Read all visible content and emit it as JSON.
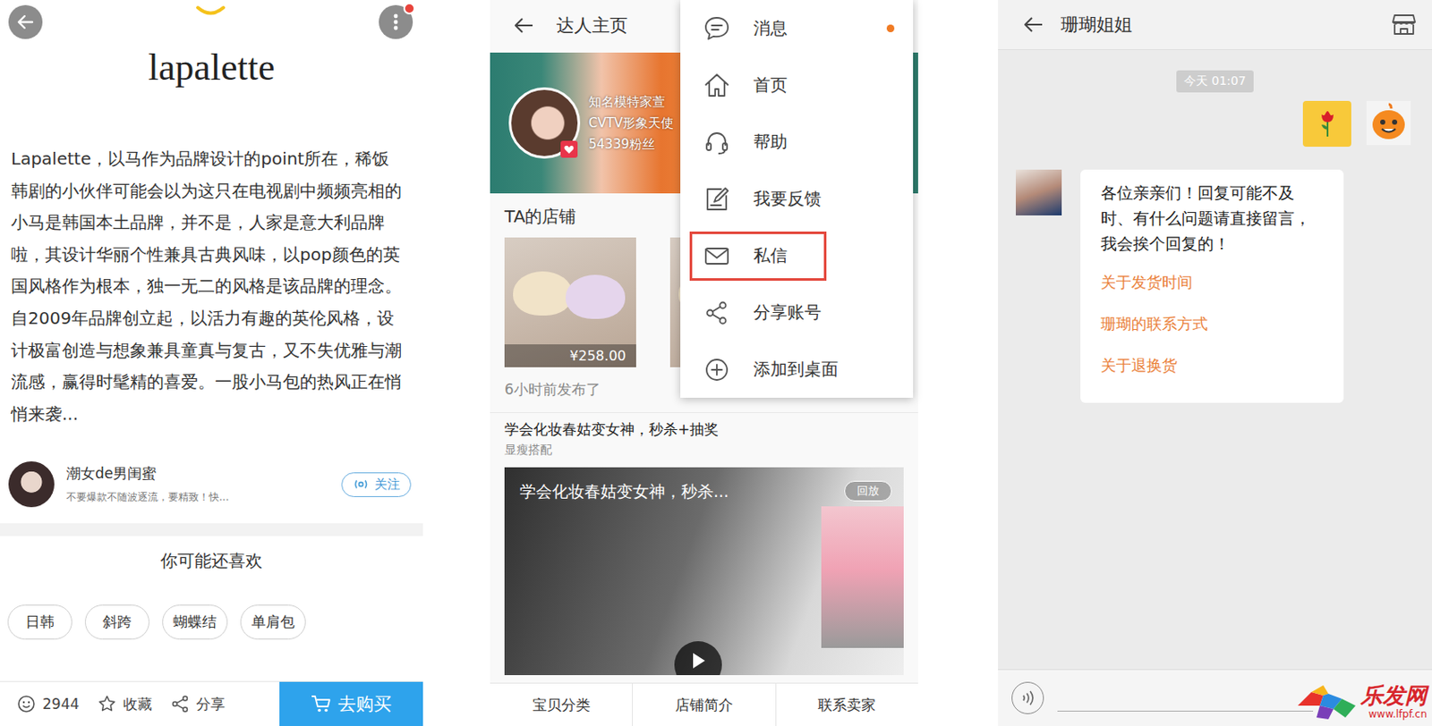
{
  "left": {
    "title": "lapalette",
    "more_badge": true,
    "paragraph": "Lapalette，以马作为品牌设计的point所在，稀饭韩剧的小伙伴可能会以为这只在电视剧中频频亮相的小马是韩国本土品牌，并不是，人家是意大利品牌啦，其设计华丽个性兼具古典风味，以pop颜色的英国风格作为根本，独一无二的风格是该品牌的理念。自2009年品牌创立起，以活力有趣的英伦风格，设计极富创造与想象兼具童真与复古，又不失优雅与潮流感，赢得时髦精的喜爱。一股小马包的热风正在悄悄来袭...",
    "author": {
      "name": "潮女de男闺蜜",
      "bio": "不要爆款不随波逐流，要精致！快...",
      "follow_label": "关注"
    },
    "related_title": "你可能还喜欢",
    "tags": [
      "日韩",
      "斜跨",
      "蝴蝶结",
      "单肩包"
    ],
    "bottom_bar": {
      "likes": "2944",
      "favorite": "收藏",
      "share": "分享",
      "buy": "去购买"
    }
  },
  "middle": {
    "header": "达人主页",
    "banner": {
      "name": "知名模特家萱",
      "subtitle": "CVTV形象天使",
      "fans": "54339粉丝"
    },
    "shop_title": "TA的店铺",
    "products": [
      {
        "price": "¥258.00"
      },
      {
        "price": null
      }
    ],
    "post": {
      "time": "6小时前发布了",
      "title": "学会化妆春姑变女神，秒杀+抽奖",
      "tag": "显瘦搭配",
      "video_title": "学会化妆春姑变女神，秒杀...",
      "video_badge": "回放"
    },
    "tabs": [
      "宝贝分类",
      "店铺简介",
      "联系卖家"
    ],
    "menu": {
      "items": [
        {
          "label": "消息",
          "badge": true,
          "selected": false
        },
        {
          "label": "首页",
          "badge": false,
          "selected": false
        },
        {
          "label": "帮助",
          "badge": false,
          "selected": false
        },
        {
          "label": "我要反馈",
          "badge": false,
          "selected": false
        },
        {
          "label": "私信",
          "badge": false,
          "selected": true
        },
        {
          "label": "分享账号",
          "badge": false,
          "selected": false
        },
        {
          "label": "添加到桌面",
          "badge": false,
          "selected": false
        }
      ]
    }
  },
  "right": {
    "title": "珊瑚姐姐",
    "time": "今天 01:07",
    "received": {
      "text": "各位亲亲们！回复可能不及时、有什么问题请直接留言，我会挨个回复的！",
      "links": [
        "关于发货时间",
        "珊瑚的联系方式",
        "关于退换货"
      ]
    }
  },
  "watermark": {
    "name": "乐发网",
    "url": "www.lfpf.cn"
  }
}
